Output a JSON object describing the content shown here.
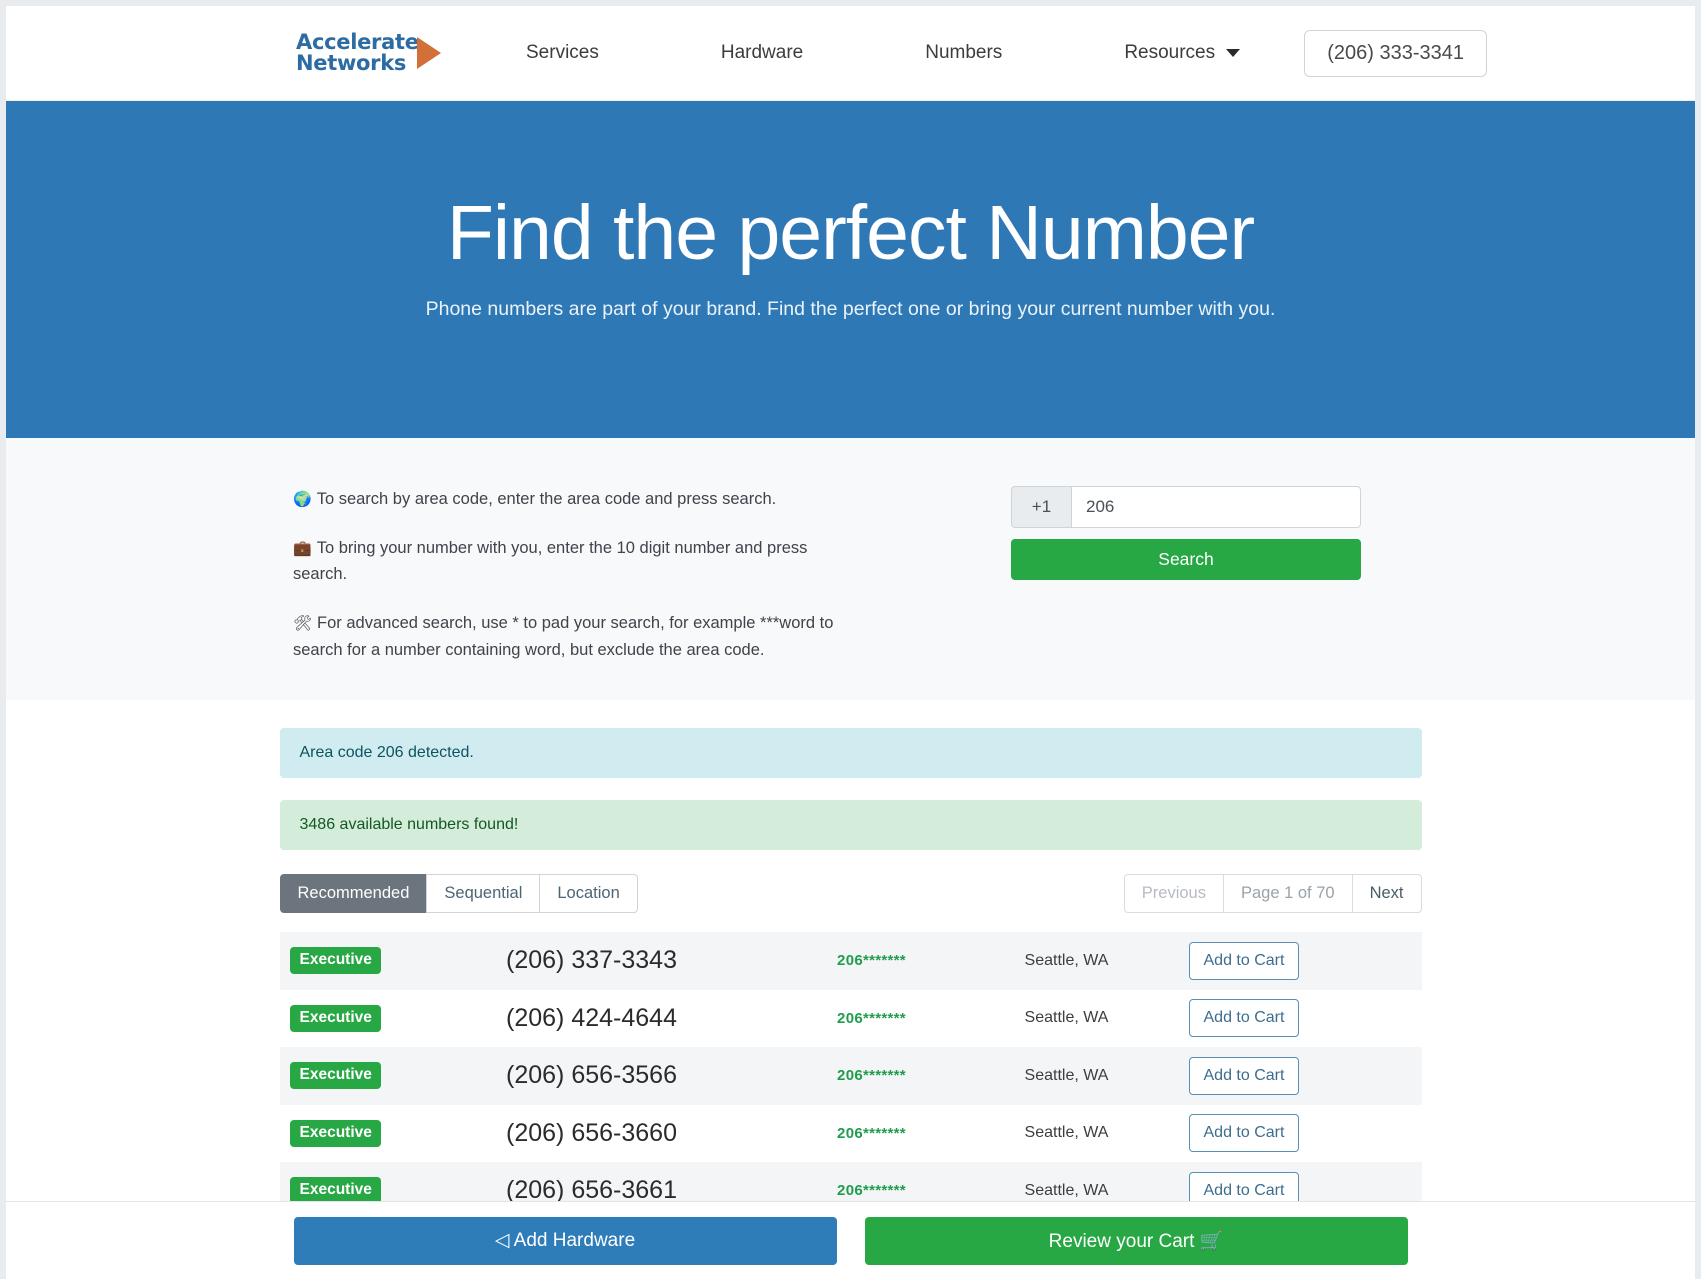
{
  "header": {
    "logo": {
      "line1": "Accelerate",
      "line2": "Networks",
      "arrow_icon": "arrow-right-icon"
    },
    "nav": [
      {
        "label": "Services",
        "name": "services"
      },
      {
        "label": "Hardware",
        "name": "hardware"
      },
      {
        "label": "Numbers",
        "name": "numbers"
      },
      {
        "label": "Resources",
        "name": "resources",
        "caret": true
      }
    ],
    "phone_label": "(206) 333-3341"
  },
  "hero": {
    "title": "Find the perfect Number",
    "subtitle": "Phone numbers are part of your brand. Find the perfect one or bring your current number with you.",
    "bg_color": "#2e79b5"
  },
  "search": {
    "tips": [
      {
        "icon": "🌍",
        "icon_name": "globe-icon",
        "text": "To search by area code, enter the area code and press search."
      },
      {
        "icon": "💼",
        "icon_name": "briefcase-icon",
        "text": "To bring your number with you, enter the 10 digit number and press search."
      },
      {
        "icon": "🛠",
        "icon_name": "tools-icon",
        "text": "For advanced search, use * to pad your search, for example ***word to search for a number containing word, but exclude the area code."
      }
    ],
    "country_prefix": "+1",
    "number_value": "206",
    "number_placeholder": "206",
    "search_button": "Search",
    "search_button_color": "#28a745"
  },
  "alerts": [
    {
      "text": "Area code 206 detected.",
      "style": "info"
    },
    {
      "text": "3486 available numbers found!",
      "style": "success"
    }
  ],
  "tabs": [
    {
      "label": "Recommended",
      "active": true
    },
    {
      "label": "Sequential",
      "active": false
    },
    {
      "label": "Location",
      "active": false
    }
  ],
  "pagination": {
    "previous": "Previous",
    "page_label": "Page 1 of 70",
    "next": "Next",
    "current_page": 1,
    "total_pages": 70
  },
  "results": {
    "add_to_cart_label": "Add to Cart",
    "rows": [
      {
        "badge": "Executive",
        "number": "(206) 337-3343",
        "mask": "206*******",
        "location": "Seattle, WA"
      },
      {
        "badge": "Executive",
        "number": "(206) 424-4644",
        "mask": "206*******",
        "location": "Seattle, WA"
      },
      {
        "badge": "Executive",
        "number": "(206) 656-3566",
        "mask": "206*******",
        "location": "Seattle, WA"
      },
      {
        "badge": "Executive",
        "number": "(206) 656-3660",
        "mask": "206*******",
        "location": "Seattle, WA"
      },
      {
        "badge": "Executive",
        "number": "(206) 656-3661",
        "mask": "206*******",
        "location": "Seattle, WA"
      }
    ]
  },
  "footer": {
    "add_hardware": "◁ Add Hardware",
    "review_cart": "Review your Cart 🛒",
    "add_hardware_color": "#2e7cb8",
    "review_cart_color": "#28a745"
  }
}
